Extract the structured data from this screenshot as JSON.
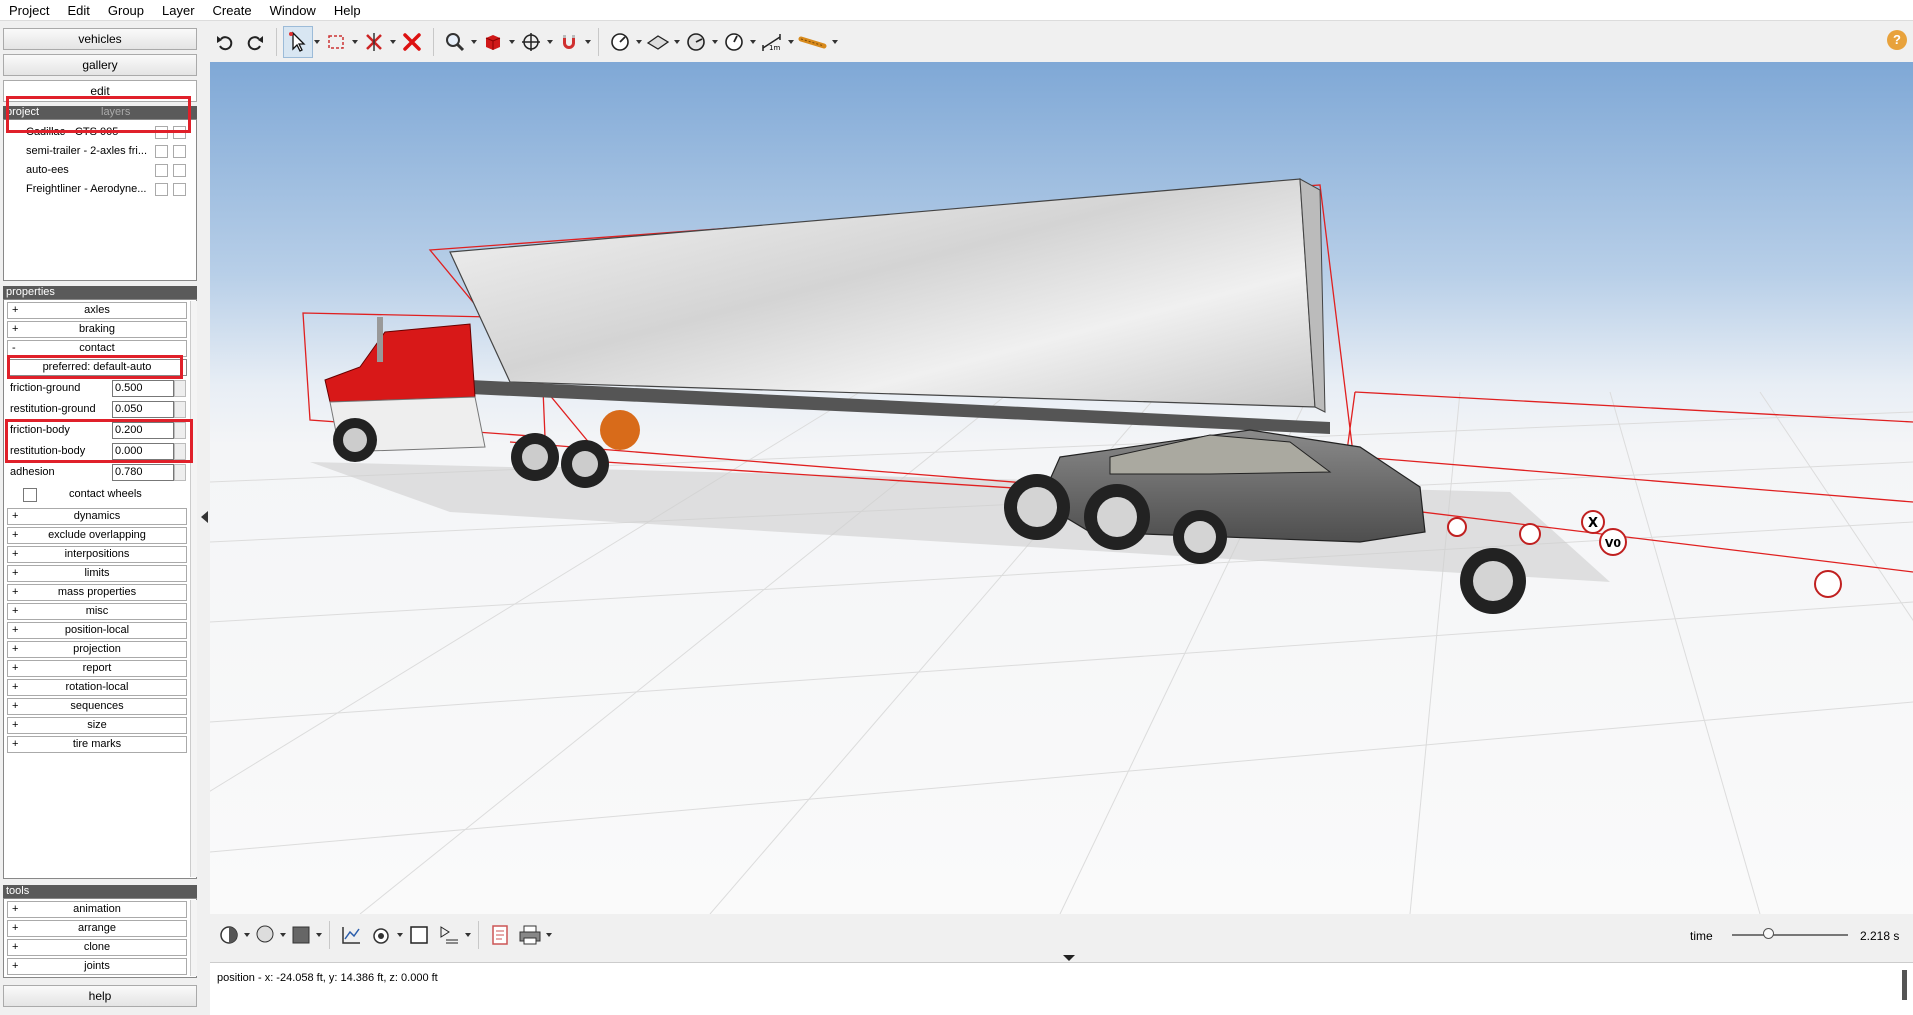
{
  "menu": [
    "Project",
    "Edit",
    "Group",
    "Layer",
    "Create",
    "Window",
    "Help"
  ],
  "sidebar": {
    "buttons": {
      "vehicles": "vehicles",
      "gallery": "gallery",
      "edit": "edit",
      "help": "help"
    },
    "project_tab": "project",
    "layers_tab": "layers",
    "project_items": [
      {
        "label": "Cadillac - CTS 005"
      },
      {
        "label": "semi-trailer - 2-axles fri..."
      },
      {
        "label": "auto-ees"
      },
      {
        "label": "Freightliner - Aerodyne..."
      }
    ],
    "properties_header": "properties",
    "sections_top": [
      {
        "sign": "+",
        "label": "axles"
      },
      {
        "sign": "+",
        "label": "braking"
      },
      {
        "sign": "-",
        "label": "contact"
      }
    ],
    "preferred_label": "preferred: default-auto",
    "fields": [
      {
        "label": "friction-ground",
        "value": "0.500"
      },
      {
        "label": "restitution-ground",
        "value": "0.050"
      },
      {
        "label": "friction-body",
        "value": "0.200"
      },
      {
        "label": "restitution-body",
        "value": "0.000"
      },
      {
        "label": "adhesion",
        "value": "0.780"
      }
    ],
    "contact_wheels_label": "contact wheels",
    "sections_bottom": [
      {
        "sign": "+",
        "label": "dynamics"
      },
      {
        "sign": "+",
        "label": "exclude overlapping"
      },
      {
        "sign": "+",
        "label": "interpositions"
      },
      {
        "sign": "+",
        "label": "limits"
      },
      {
        "sign": "+",
        "label": "mass properties"
      },
      {
        "sign": "+",
        "label": "misc"
      },
      {
        "sign": "+",
        "label": "position-local"
      },
      {
        "sign": "+",
        "label": "projection"
      },
      {
        "sign": "+",
        "label": "report"
      },
      {
        "sign": "+",
        "label": "rotation-local"
      },
      {
        "sign": "+",
        "label": "sequences"
      },
      {
        "sign": "+",
        "label": "size"
      },
      {
        "sign": "+",
        "label": "tire marks"
      }
    ],
    "tools_header": "tools",
    "tools": [
      {
        "sign": "+",
        "label": "animation"
      },
      {
        "sign": "+",
        "label": "arrange"
      },
      {
        "sign": "+",
        "label": "clone"
      },
      {
        "sign": "+",
        "label": "joints"
      }
    ]
  },
  "viewport": {
    "handles": [
      "X",
      "V0"
    ]
  },
  "time": {
    "label": "time",
    "value": "2.218 s",
    "position": 0.31
  },
  "status": {
    "text": "position - x: -24.058 ft, y: 14.386 ft, z: 0.000 ft"
  },
  "help_icon": "?"
}
